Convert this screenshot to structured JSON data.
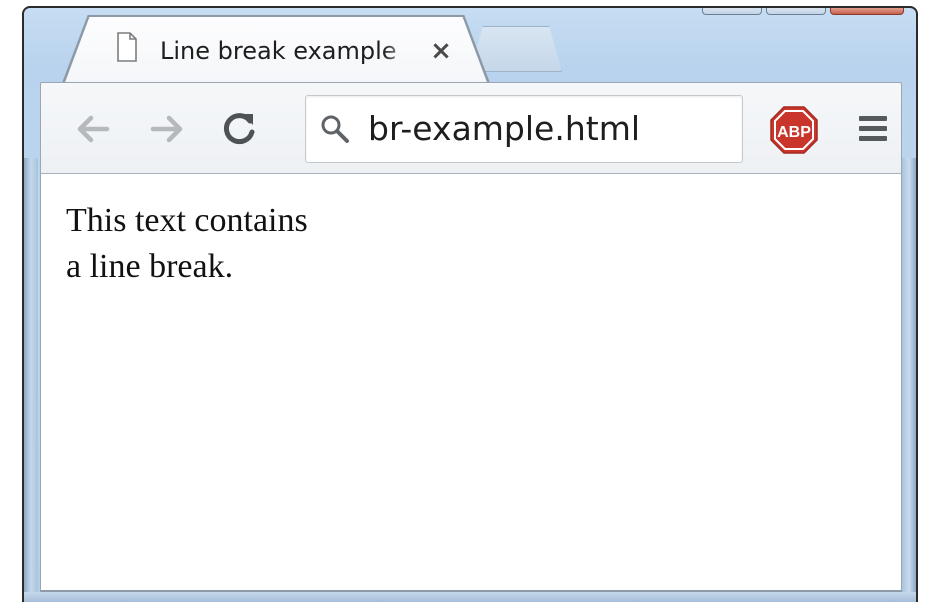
{
  "browser": {
    "tabs": [
      {
        "title": "Line break example",
        "active": true,
        "close_label": "×"
      }
    ],
    "omnibox": {
      "value": "br-example.html"
    },
    "extensions": [
      {
        "name": "adblock-plus",
        "label": "ABP",
        "color": "#c9352b"
      }
    ],
    "icons": {
      "back": "back-arrow-icon",
      "forward": "forward-arrow-icon",
      "reload": "reload-icon",
      "search": "search-icon",
      "menu": "hamburger-menu-icon",
      "page": "document-icon"
    },
    "colors": {
      "frame": "#bcd6ef",
      "toolbar": "#f1f4f7"
    }
  },
  "page": {
    "lines": [
      "This text contains",
      "a line break."
    ]
  }
}
